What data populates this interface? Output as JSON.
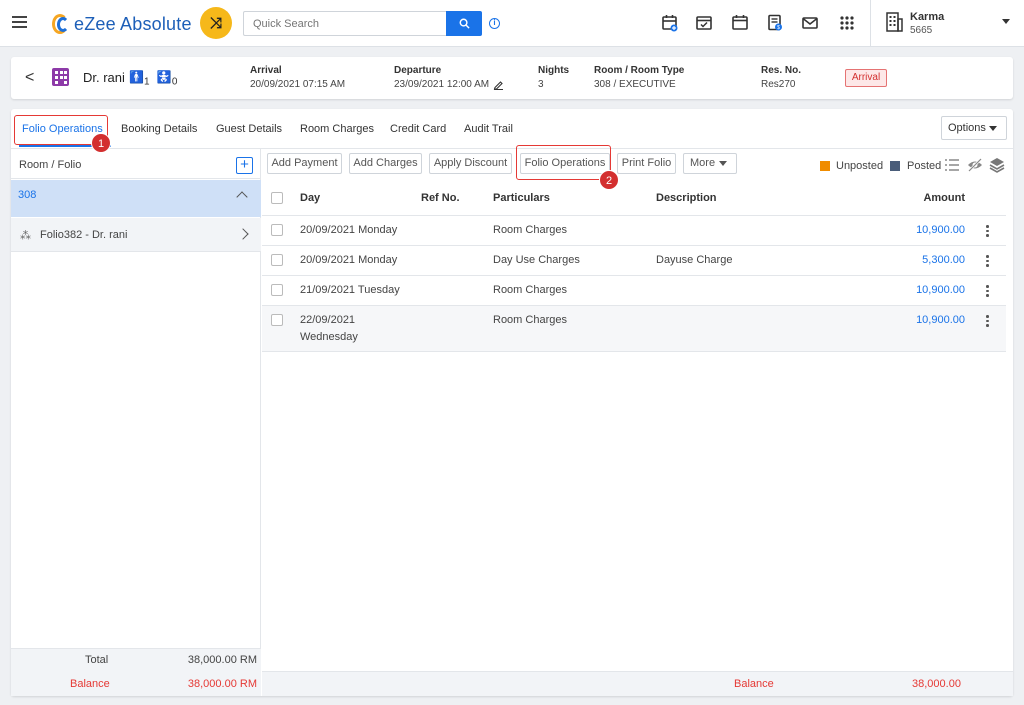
{
  "topbar": {
    "brand": "eZee Absolute",
    "search_placeholder": "Quick Search",
    "info_label": "i",
    "icons": [
      "calendar-plus-icon",
      "calendar-check-icon",
      "calendar-icon",
      "billing-icon",
      "mail-icon",
      "apps-grid-icon"
    ],
    "user": {
      "name": "Karma",
      "id": "5665"
    }
  },
  "reservation": {
    "back_label": "<",
    "guest_name": "Dr. rani",
    "adults": "1",
    "children": "0",
    "arrival_label": "Arrival",
    "arrival_value": "20/09/2021 07:15 AM",
    "departure_label": "Departure",
    "departure_value": "23/09/2021 12:00 AM",
    "nights_label": "Nights",
    "nights_value": "3",
    "room_label": "Room / Room Type",
    "room_value": "308 / EXECUTIVE",
    "resno_label": "Res. No.",
    "resno_value": "Res270",
    "status_badge": "Arrival"
  },
  "tabs": [
    {
      "label": "Folio Operations",
      "active": true
    },
    {
      "label": "Booking Details"
    },
    {
      "label": "Guest Details"
    },
    {
      "label": "Room Charges"
    },
    {
      "label": "Credit Card"
    },
    {
      "label": "Audit Trail"
    }
  ],
  "options_label": "Options",
  "callouts": {
    "first": "1",
    "second": "2"
  },
  "left_panel": {
    "header": "Room / Folio",
    "plus": "+",
    "room": "308",
    "folio_icon": "⁂",
    "folio": "Folio382 - Dr. rani",
    "total_label": "Total",
    "total_value": "38,000.00 RM",
    "balance_label": "Balance",
    "balance_value": "38,000.00 RM"
  },
  "actions": {
    "add_payment": "Add Payment",
    "add_charges": "Add Charges",
    "apply_discount": "Apply Discount",
    "folio_operations": "Folio Operations",
    "print_folio": "Print Folio",
    "more": "More"
  },
  "legend": {
    "unposted": {
      "label": "Unposted",
      "color": "#f08c00"
    },
    "posted": {
      "label": "Posted",
      "color": "#4a5d7a"
    }
  },
  "columns": {
    "day": "Day",
    "ref": "Ref No.",
    "particulars": "Particulars",
    "description": "Description",
    "amount": "Amount"
  },
  "rows": [
    {
      "day": "20/09/2021 Monday",
      "ref": "",
      "particulars": "Room Charges",
      "description": "",
      "amount": "10,900.00"
    },
    {
      "day": "20/09/2021 Monday",
      "ref": "",
      "particulars": "Day Use Charges",
      "description": "Dayuse Charge",
      "amount": "5,300.00"
    },
    {
      "day": "21/09/2021 Tuesday",
      "ref": "",
      "particulars": "Room Charges",
      "description": "",
      "amount": "10,900.00"
    },
    {
      "day": "22/09/2021 Wednesday",
      "ref": "",
      "particulars": "Room Charges",
      "description": "",
      "amount": "10,900.00"
    }
  ],
  "footer": {
    "balance_label": "Balance",
    "balance_value": "38,000.00"
  }
}
